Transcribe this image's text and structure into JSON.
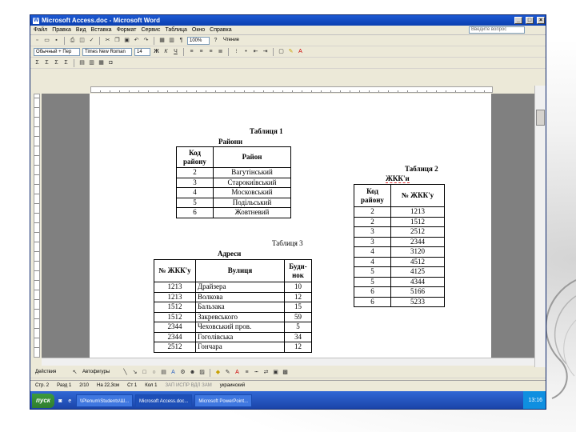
{
  "window": {
    "title": "Microsoft Access.doc - Microsoft Word"
  },
  "menu": {
    "items": [
      "Файл",
      "Правка",
      "Вид",
      "Вставка",
      "Формат",
      "Сервис",
      "Таблица",
      "Окно",
      "Справка"
    ],
    "help_placeholder": "Введите вопрос"
  },
  "toolbar": {
    "zoom": "100%",
    "read_label": "Чтение",
    "style": "Обычный + Пер",
    "font": "Times New Roman",
    "size": "14"
  },
  "table1": {
    "caption": "Таблиця 1",
    "title": "Райони",
    "headers": [
      "Код району",
      "Район"
    ],
    "rows": [
      [
        "2",
        "Вагутінський"
      ],
      [
        "3",
        "Старокиївський"
      ],
      [
        "4",
        "Московський"
      ],
      [
        "5",
        "Подільський"
      ],
      [
        "6",
        "Жовтневий"
      ]
    ]
  },
  "table2": {
    "caption": "Таблиця 2",
    "title": "ЖКК'и",
    "headers": [
      "Код району",
      "№ ЖКК'у"
    ],
    "rows": [
      [
        "2",
        "1213"
      ],
      [
        "2",
        "1512"
      ],
      [
        "3",
        "2512"
      ],
      [
        "3",
        "2344"
      ],
      [
        "4",
        "3120"
      ],
      [
        "4",
        "4512"
      ],
      [
        "5",
        "4125"
      ],
      [
        "5",
        "4344"
      ],
      [
        "6",
        "5166"
      ],
      [
        "6",
        "5233"
      ]
    ]
  },
  "table3": {
    "caption": "Таблиця 3",
    "title": "Адреси",
    "headers": [
      "№ ЖКК'у",
      "Вулиця",
      "Буди-нок"
    ],
    "rows": [
      [
        "1213",
        "Драйзера",
        "10"
      ],
      [
        "1213",
        "Волкова",
        "12"
      ],
      [
        "1512",
        "Бальзака",
        "15"
      ],
      [
        "1512",
        "Закревського",
        "59"
      ],
      [
        "2344",
        "Чеховський пров.",
        "5"
      ],
      [
        "2344",
        "Гоголівська",
        "34"
      ],
      [
        "2512",
        "Гончара",
        "12"
      ]
    ]
  },
  "drawbar": {
    "actions_label": "Действия",
    "autoshapes_label": "Автофигуры"
  },
  "status": {
    "page": "Стр. 2",
    "section": "Разд 1",
    "pages": "2/10",
    "position": "На 22,3см",
    "line": "Ст 1",
    "col": "Кол 1",
    "modes": "ЗАП ИСПР ВДЛ ЗАМ",
    "lang": "украинский"
  },
  "taskbar": {
    "start_label": "пуск",
    "tasks": [
      "\\\\Plenum\\Students\\Ш...",
      "Microsoft Access.doc...",
      "Microsoft PowerPoint..."
    ],
    "clock": "13:16"
  }
}
